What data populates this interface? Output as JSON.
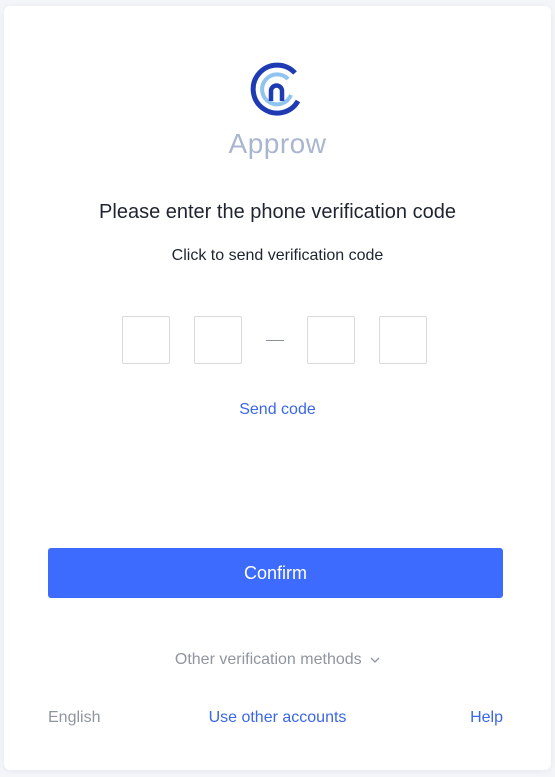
{
  "app": {
    "name": "Approw"
  },
  "form": {
    "title": "Please enter the phone verification code",
    "subtitle": "Click to send verification code",
    "code_digits": [
      "",
      "",
      "",
      ""
    ],
    "send_code_label": "Send code",
    "confirm_label": "Confirm"
  },
  "other_methods": {
    "label": "Other verification methods"
  },
  "footer": {
    "language": "English",
    "other_accounts": "Use other accounts",
    "help": "Help"
  },
  "colors": {
    "primary": "#3d6bfd",
    "link": "#3a67e8",
    "logo_dark": "#1f3bb3",
    "logo_light": "#8fc3f0",
    "brand_text": "#aab6cf"
  },
  "icons": {
    "logo": "approw-logo-icon",
    "chevron": "chevron-down-icon"
  }
}
